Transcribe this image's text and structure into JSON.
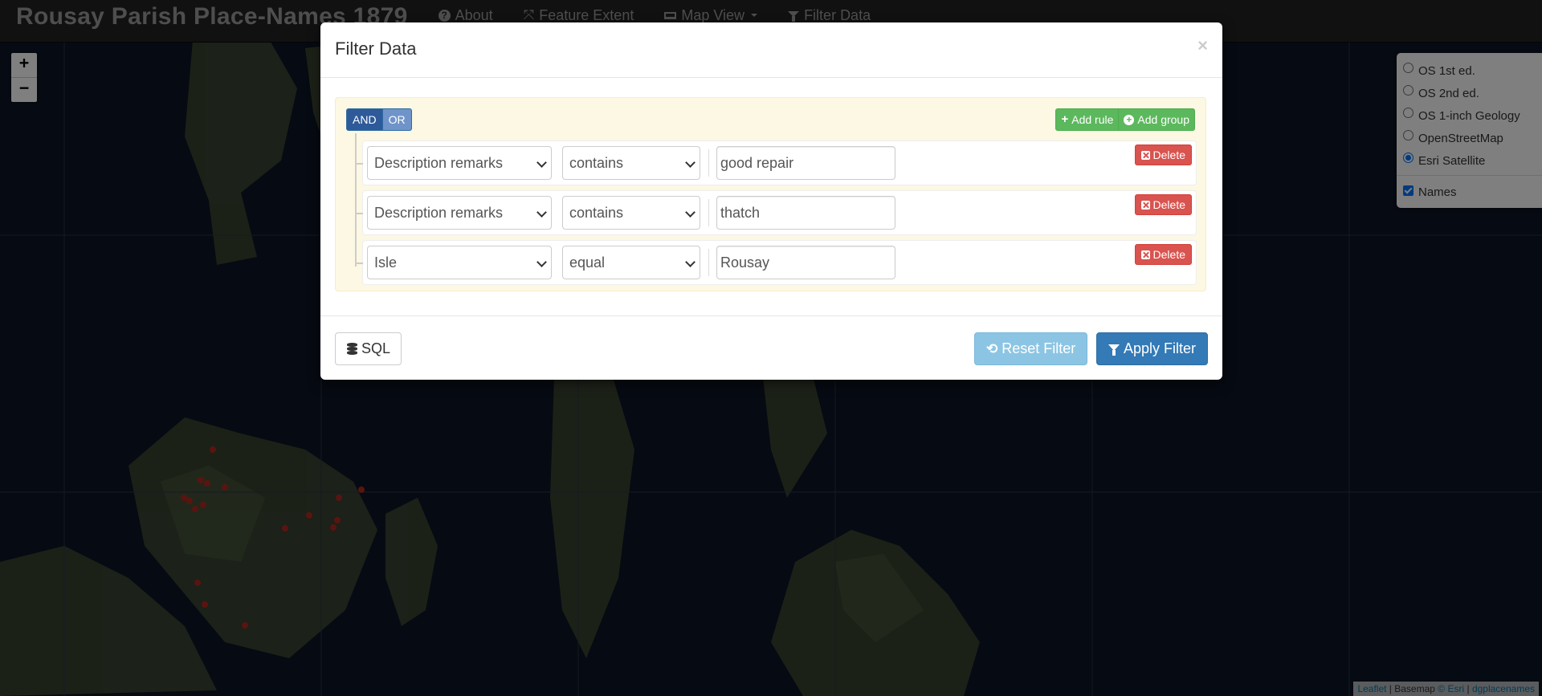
{
  "navbar": {
    "brand": "Rousay Parish Place-Names 1879",
    "items": [
      {
        "label": "About",
        "icon": "question-circle-icon"
      },
      {
        "label": "Feature Extent",
        "icon": "expand-arrows-icon"
      },
      {
        "label": "Map View",
        "icon": "laptop-icon"
      },
      {
        "label": "Filter Data",
        "icon": "filter-icon"
      }
    ]
  },
  "zoom": {
    "in": "+",
    "out": "−"
  },
  "layers": {
    "basemaps": [
      {
        "label": "OS 1st ed.",
        "checked": false
      },
      {
        "label": "OS 2nd ed.",
        "checked": false
      },
      {
        "label": "OS 1-inch Geology",
        "checked": false
      },
      {
        "label": "OpenStreetMap",
        "checked": false
      },
      {
        "label": "Esri Satellite",
        "checked": true
      }
    ],
    "overlays": [
      {
        "label": "Names",
        "checked": true
      }
    ]
  },
  "attribution": {
    "leaflet": "Leaflet",
    "sep1": " | Basemap ",
    "esri": "© Esri",
    "sep2": " | ",
    "dg": "dgplacenames"
  },
  "modal": {
    "title": "Filter Data",
    "close": "×",
    "conditions": {
      "and": "AND",
      "or": "OR",
      "active": "AND"
    },
    "add_rule": "Add rule",
    "add_group": "Add group",
    "rules": [
      {
        "field": "Description remarks",
        "operator": "contains",
        "value": "good repair",
        "delete": "Delete"
      },
      {
        "field": "Description remarks",
        "operator": "contains",
        "value": "thatch",
        "delete": "Delete"
      },
      {
        "field": "Isle",
        "operator": "equal",
        "value": "Rousay",
        "delete": "Delete"
      }
    ],
    "sql_button": "SQL",
    "reset_button": "Reset Filter",
    "apply_button": "Apply Filter"
  },
  "colors": {
    "navbar_bg": "#222222",
    "primary": "#337ab7",
    "success": "#5cb85c",
    "danger": "#d9534f",
    "info_light": "#8cc5e4",
    "group_bg": "#fcf8e3"
  }
}
